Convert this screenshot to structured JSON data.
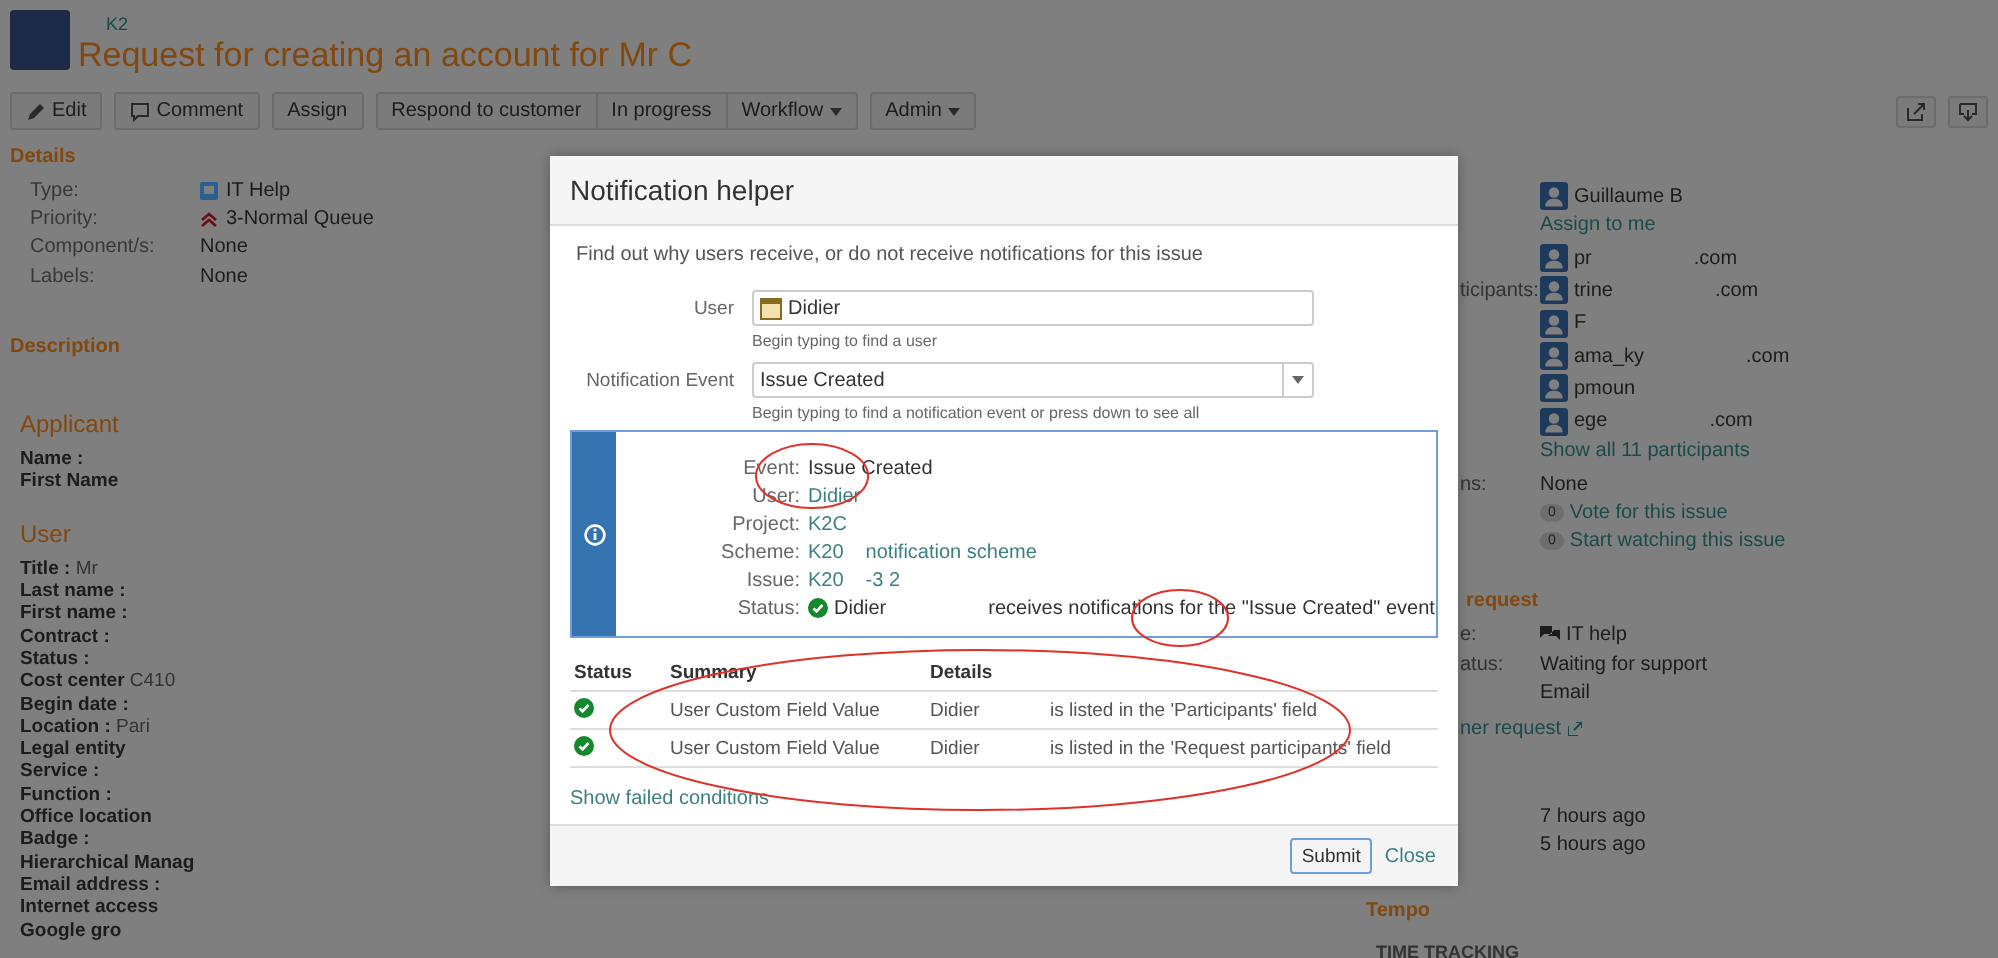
{
  "header": {
    "breadcrumb": "K2",
    "title": "Request for creating an account for Mr C"
  },
  "toolbar": [
    [
      {
        "label": "Edit",
        "dropdown": false
      }
    ],
    [
      {
        "label": "Comment",
        "dropdown": false
      }
    ],
    [
      {
        "label": "Assign",
        "dropdown": false
      }
    ],
    [
      {
        "label": "Respond to customer",
        "dropdown": false
      },
      {
        "label": "In progress",
        "dropdown": false
      },
      {
        "label": "Workflow",
        "dropdown": true
      }
    ],
    [
      {
        "label": "Admin",
        "dropdown": true
      }
    ]
  ],
  "details": {
    "heading": "Details",
    "fields": [
      {
        "label": "Type:",
        "value": "IT Help"
      },
      {
        "label": "Priority:",
        "value": "3-Normal Queue"
      },
      {
        "label": "Component/s:",
        "value": "None"
      },
      {
        "label": "Labels:",
        "value": "None"
      }
    ]
  },
  "description": {
    "heading": "Description"
  },
  "applicant": {
    "heading": "Applicant",
    "lines": [
      {
        "label": "Name :"
      },
      {
        "label": "First Name"
      }
    ]
  },
  "user_section": {
    "heading": "User",
    "lines": [
      {
        "label": "Title :",
        "value": "Mr"
      },
      {
        "label": "Last name :"
      },
      {
        "label": "First name :"
      },
      {
        "label": "Contract :"
      },
      {
        "label": "Status :"
      },
      {
        "label": "Cost center",
        "value": "C410"
      },
      {
        "label": "Begin date :"
      },
      {
        "label": "Location :",
        "value": "Pari"
      },
      {
        "label": "Legal entity"
      },
      {
        "label": "Service :"
      },
      {
        "label": "Function :"
      },
      {
        "label": "Office location"
      },
      {
        "label": "Badge :"
      },
      {
        "label": "Hierarchical Manag"
      },
      {
        "label": "Email address :"
      },
      {
        "label": "Internet access"
      },
      {
        "label": "Google gro"
      }
    ]
  },
  "people": {
    "assignee": "Guillaume B",
    "assign_me": "Assign to me",
    "participants_label": "ticipants:",
    "participants": [
      {
        "name": "pr",
        "domain": ".com"
      },
      {
        "name": "trine",
        "domain": ".com"
      },
      {
        "name": "F"
      },
      {
        "name": "ama_ky",
        "domain": ".com"
      },
      {
        "name": "pmoun"
      },
      {
        "name": "ege",
        "domain": ".com"
      }
    ],
    "show_all": "Show all 11 participants",
    "votes_label": "ns:",
    "votes_value": "None",
    "vote": {
      "count": "0",
      "label": "Vote for this issue"
    },
    "watch": {
      "count": "0",
      "label": "Start watching this issue"
    }
  },
  "request": {
    "heading": "request",
    "type_label": "e:",
    "type_value": "IT help",
    "status_label": "atus:",
    "status_value": "Waiting for support",
    "channel": "Email",
    "link": "ner request"
  },
  "dates": [
    "7 hours ago",
    "5 hours ago"
  ],
  "tempo": {
    "heading": "Tempo",
    "section": "TIME TRACKING"
  },
  "dialog": {
    "title": "Notification helper",
    "intro": "Find out why users receive, or do not receive notifications for this issue",
    "user_field": {
      "label": "User",
      "value": "Didier",
      "hint": "Begin typing to find a user"
    },
    "event_field": {
      "label": "Notification Event",
      "value": "Issue Created",
      "hint": "Begin typing to find a notification event or press down to see all"
    },
    "result": [
      {
        "label": "Event:",
        "kind": "text",
        "values": [
          "Issue Created"
        ]
      },
      {
        "label": "User:",
        "kind": "link",
        "values": [
          "Didier"
        ]
      },
      {
        "label": "Project:",
        "kind": "link",
        "values": [
          "K2C"
        ]
      },
      {
        "label": "Scheme:",
        "kind": "link",
        "values": [
          "K20",
          "notification scheme"
        ]
      },
      {
        "label": "Issue:",
        "kind": "link",
        "values": [
          "K20",
          "-3 2"
        ]
      },
      {
        "label": "Status:",
        "kind": "status",
        "values": [
          "Didier",
          "receives notifications for the \"Issue Created\" event"
        ]
      }
    ],
    "columns": [
      "Status",
      "Summary",
      "Details"
    ],
    "rows": [
      {
        "passed": true,
        "summary": "User Custom Field Value",
        "user": "Didier",
        "detail": "is listed in the 'Participants' field"
      },
      {
        "passed": true,
        "summary": "User Custom Field Value",
        "user": "Didier",
        "detail": "is listed in the 'Request participants' field"
      }
    ],
    "show_failed": "Show failed conditions",
    "submit": "Submit",
    "close": "Close"
  }
}
